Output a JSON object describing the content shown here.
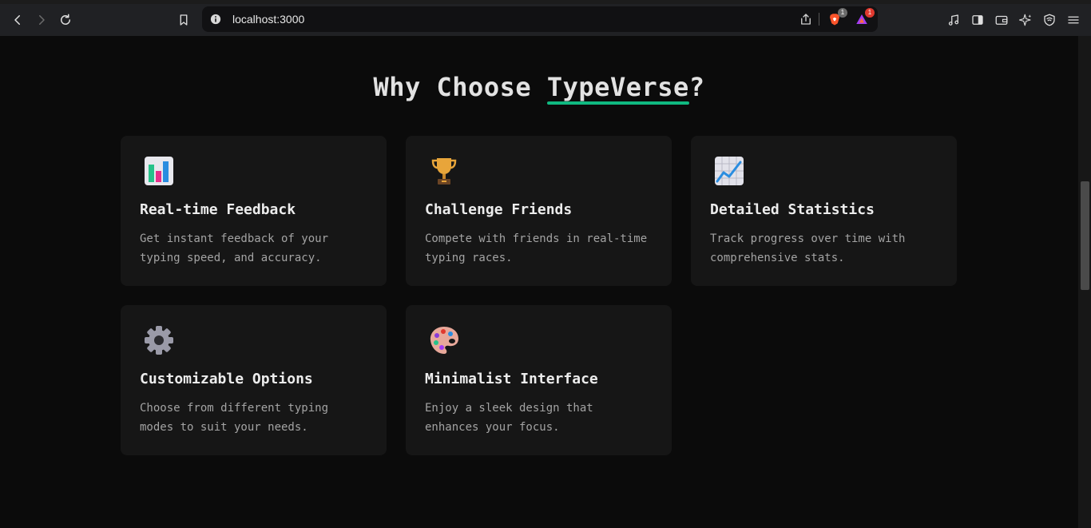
{
  "browser": {
    "url": "localhost:3000",
    "brave_badge": "1",
    "rewards_badge": "1"
  },
  "section": {
    "title_prefix": "Why Choose ",
    "title_brand": "TypeVerse",
    "title_suffix": "?",
    "accent_color": "#10b981"
  },
  "features": [
    {
      "icon": "bar-chart-icon",
      "title": "Real-time Feedback",
      "description": "Get instant feedback of your typing speed, and accuracy."
    },
    {
      "icon": "trophy-icon",
      "title": "Challenge Friends",
      "description": "Compete with friends in real-time typing races."
    },
    {
      "icon": "trend-chart-icon",
      "title": "Detailed Statistics",
      "description": "Track progress over time with comprehensive stats."
    },
    {
      "icon": "gear-icon",
      "title": "Customizable Options",
      "description": "Choose from different typing modes to suit your needs."
    },
    {
      "icon": "palette-icon",
      "title": "Minimalist Interface",
      "description": "Enjoy a sleek design that enhances your focus."
    }
  ]
}
